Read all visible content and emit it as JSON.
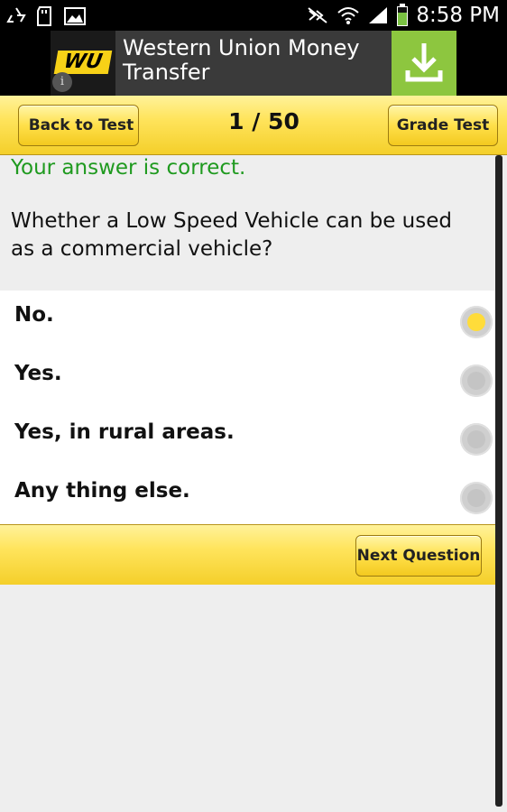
{
  "status_bar": {
    "time": "8:58 PM",
    "icons": [
      "recycle-icon",
      "sd-card-icon",
      "image-icon",
      "mute-icon",
      "wifi-icon",
      "signal-icon",
      "battery-icon"
    ]
  },
  "ad": {
    "logo_text": "WU",
    "title": "Western Union Money Transfer",
    "info_glyph": "i",
    "accent_color": "#8dc63f",
    "brand_color": "#f7d117"
  },
  "toolbar": {
    "back_label": "Back to Test",
    "counter": "1 / 50",
    "grade_label": "Grade Test"
  },
  "question": {
    "feedback": "Your answer is correct.",
    "text": "Whether a Low Speed Vehicle can be used as a commercial vehicle?",
    "feedback_color": "#1f9a1f"
  },
  "options": [
    {
      "label": "No.",
      "selected": true
    },
    {
      "label": "Yes.",
      "selected": false
    },
    {
      "label": "Yes, in rural areas.",
      "selected": false
    },
    {
      "label": "Any thing else.",
      "selected": false
    }
  ],
  "footer": {
    "next_label": "Next Question"
  }
}
